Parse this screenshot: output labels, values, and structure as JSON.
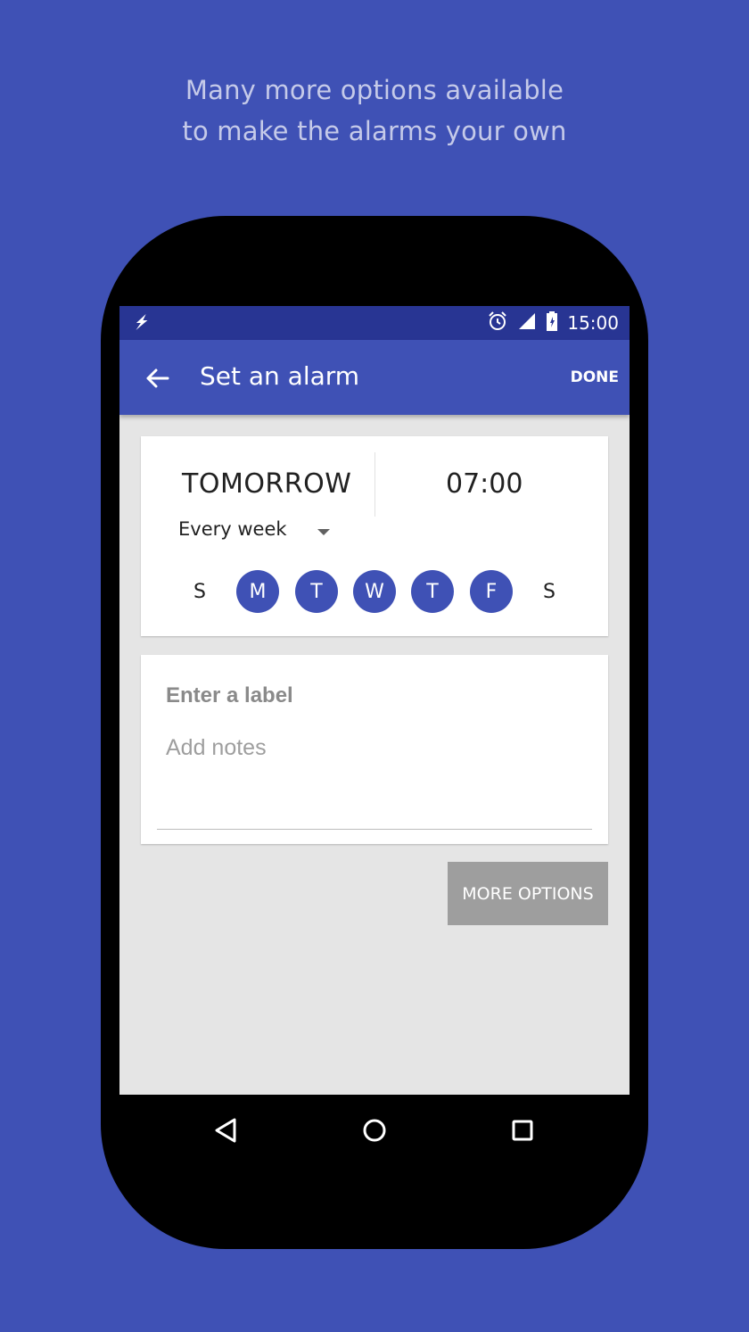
{
  "promo": {
    "line1": "Many more options available",
    "line2": "to make the alarms your own"
  },
  "colors": {
    "background": "#3f51b5",
    "promo_text": "#c5cae9",
    "status_bar": "#283593",
    "app_bar": "#3f51b5",
    "day_selected": "#3f51b5",
    "more_options_button": "#9e9e9e"
  },
  "status_bar": {
    "icons": [
      "flash-icon",
      "alarm-icon",
      "signal-icon",
      "battery-icon"
    ],
    "time": "15:00"
  },
  "app_bar": {
    "back_icon": "arrow-back-icon",
    "title": "Set an alarm",
    "done_label": "DONE"
  },
  "alarm": {
    "day": "TOMORROW",
    "time": "07:00",
    "repeat": "Every week",
    "days": [
      {
        "label": "S",
        "selected": false
      },
      {
        "label": "M",
        "selected": true
      },
      {
        "label": "T",
        "selected": true
      },
      {
        "label": "W",
        "selected": true
      },
      {
        "label": "T",
        "selected": true
      },
      {
        "label": "F",
        "selected": true
      },
      {
        "label": "S",
        "selected": false
      }
    ]
  },
  "label_card": {
    "label_placeholder": "Enter a label",
    "notes_placeholder": "Add notes"
  },
  "more_options_label": "MORE OPTIONS",
  "nav_bar": {
    "icons": [
      "back-triangle-icon",
      "home-circle-icon",
      "recents-square-icon"
    ]
  }
}
